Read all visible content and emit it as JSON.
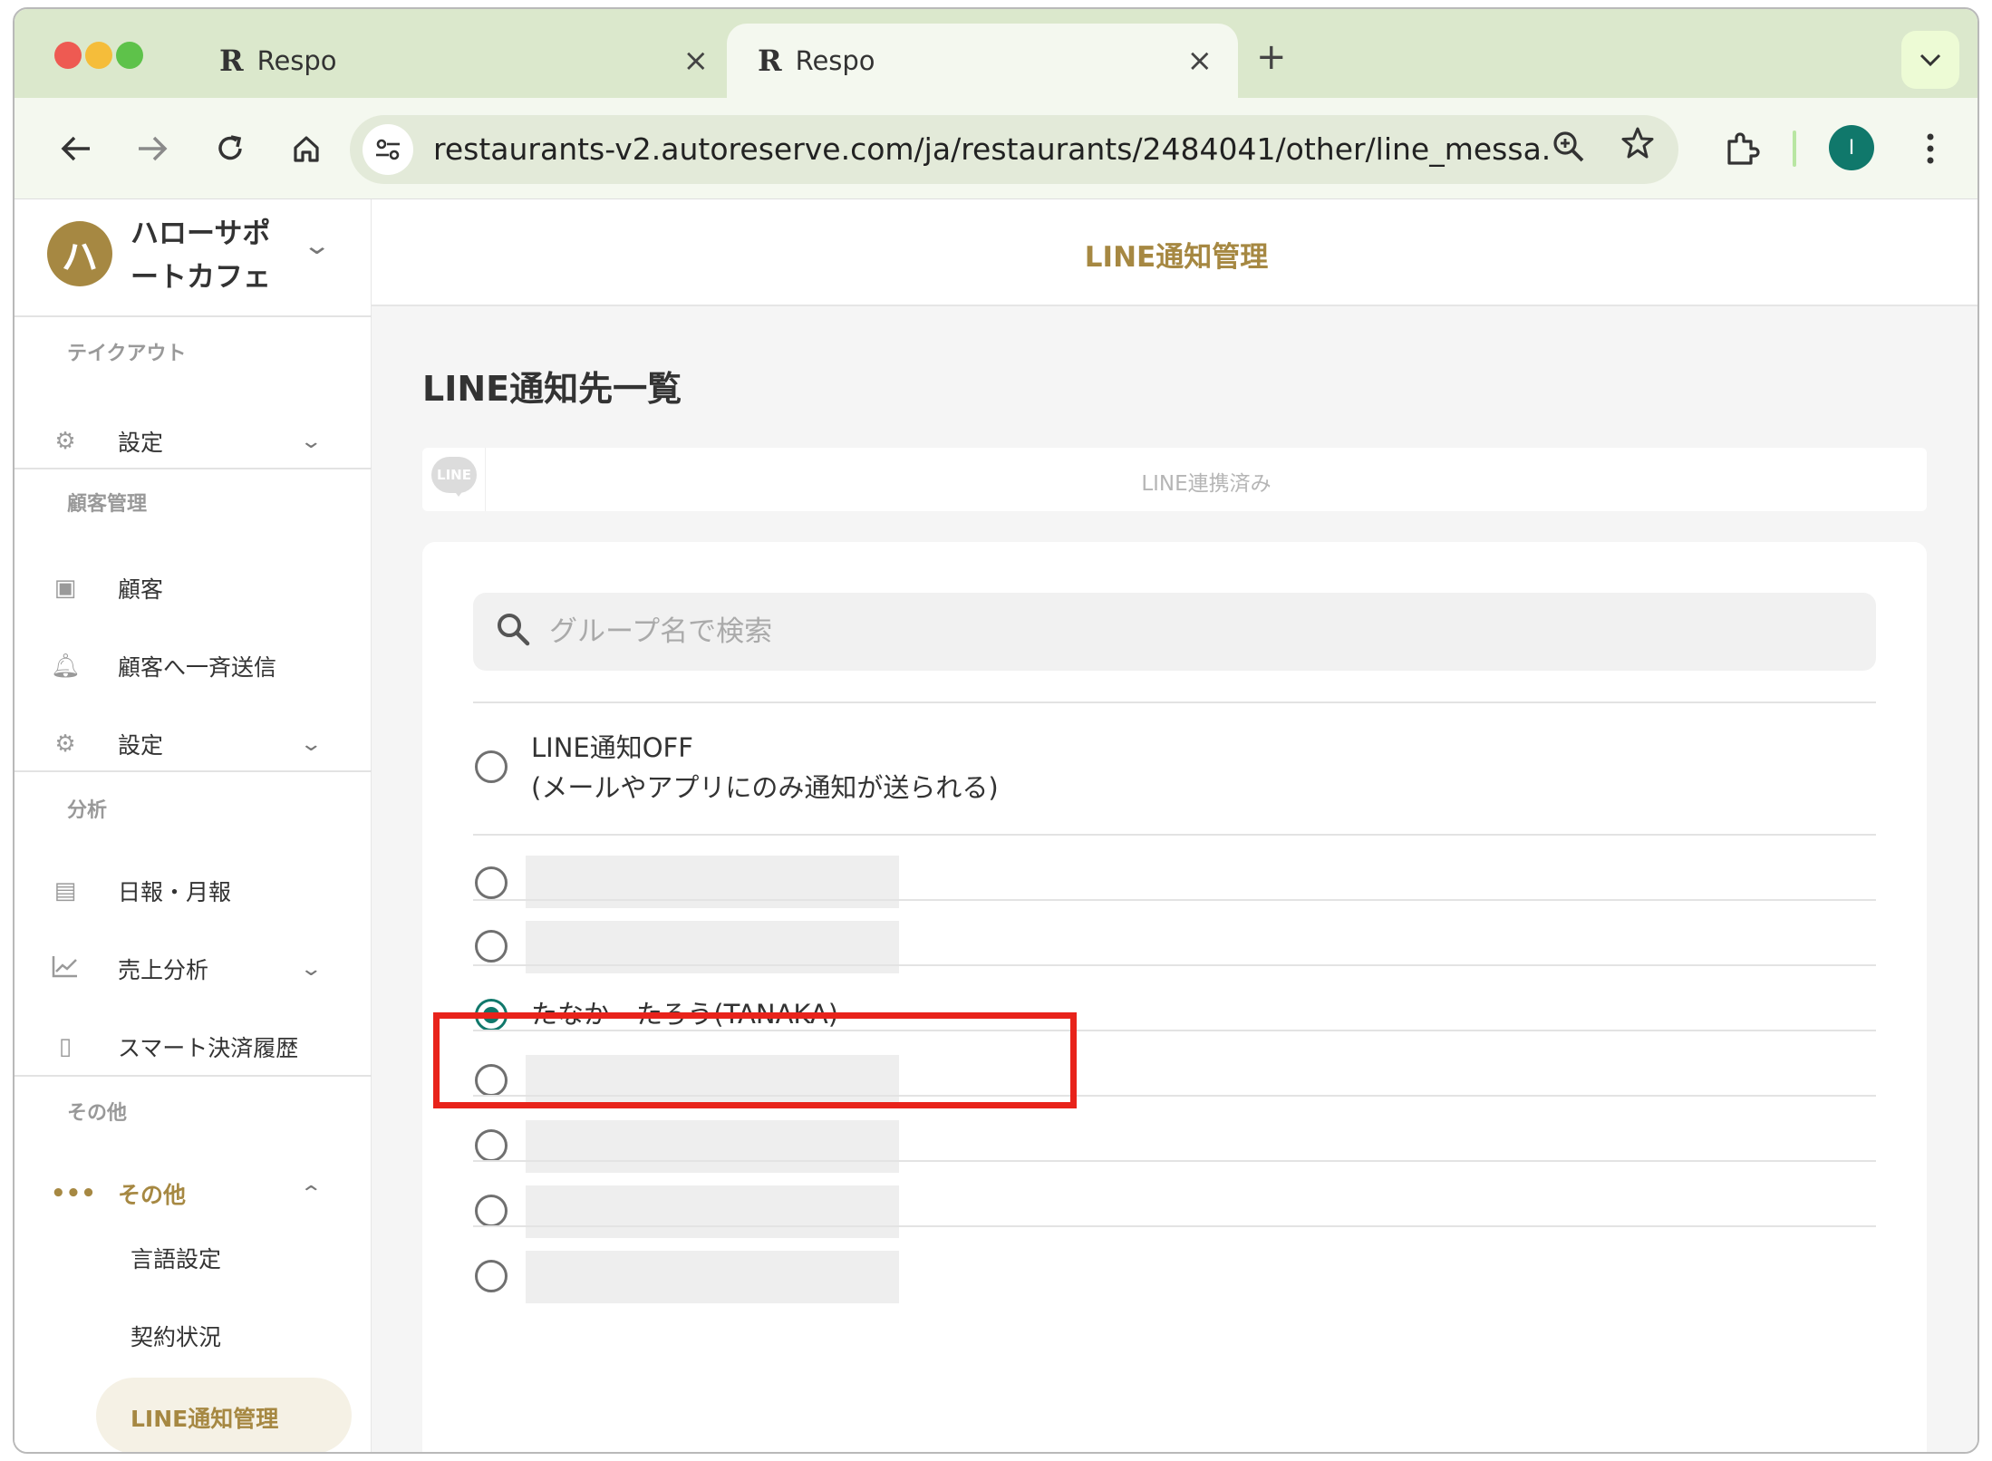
{
  "browser": {
    "tabs": [
      {
        "label": "Respo",
        "logo": "R"
      },
      {
        "label": "Respo",
        "logo": "R"
      }
    ],
    "new_tab": "+",
    "url": "restaurants-v2.autoreserve.com/ja/restaurants/2484041/other/line_messa...",
    "profile_initial": "I",
    "accent_color": "#dbe8cc"
  },
  "sidebar": {
    "store_initial": "ハ",
    "store_name": "ハローサポートカフェ",
    "sections": {
      "takeout": "テイクアウト",
      "customer": "顧客管理",
      "analysis": "分析",
      "other": "その他"
    },
    "items": {
      "takeout_settings": "設定",
      "customers": "顧客",
      "broadcast": "顧客へ一斉送信",
      "customer_settings": "設定",
      "daily_report": "日報・月報",
      "sales_analysis": "売上分析",
      "smart_payment": "スマート決済履歴",
      "other": "その他",
      "language": "言語設定",
      "contract": "契約状況",
      "line_manage": "LINE通知管理"
    },
    "brand_color": "#a68842"
  },
  "main": {
    "header_title": "LINE通知管理",
    "page_title": "LINE通知先一覧",
    "line_badge": "LINE",
    "line_status": "LINE連携済み",
    "search_placeholder": "グループ名で検索",
    "options": {
      "off_line1": "LINE通知OFF",
      "off_line2": "(メールやアプリにのみ通知が送られる)",
      "selected": "たなか　たろう(TANAKA)"
    },
    "selected_color": "#10786b",
    "highlight_color": "#e8231b"
  }
}
